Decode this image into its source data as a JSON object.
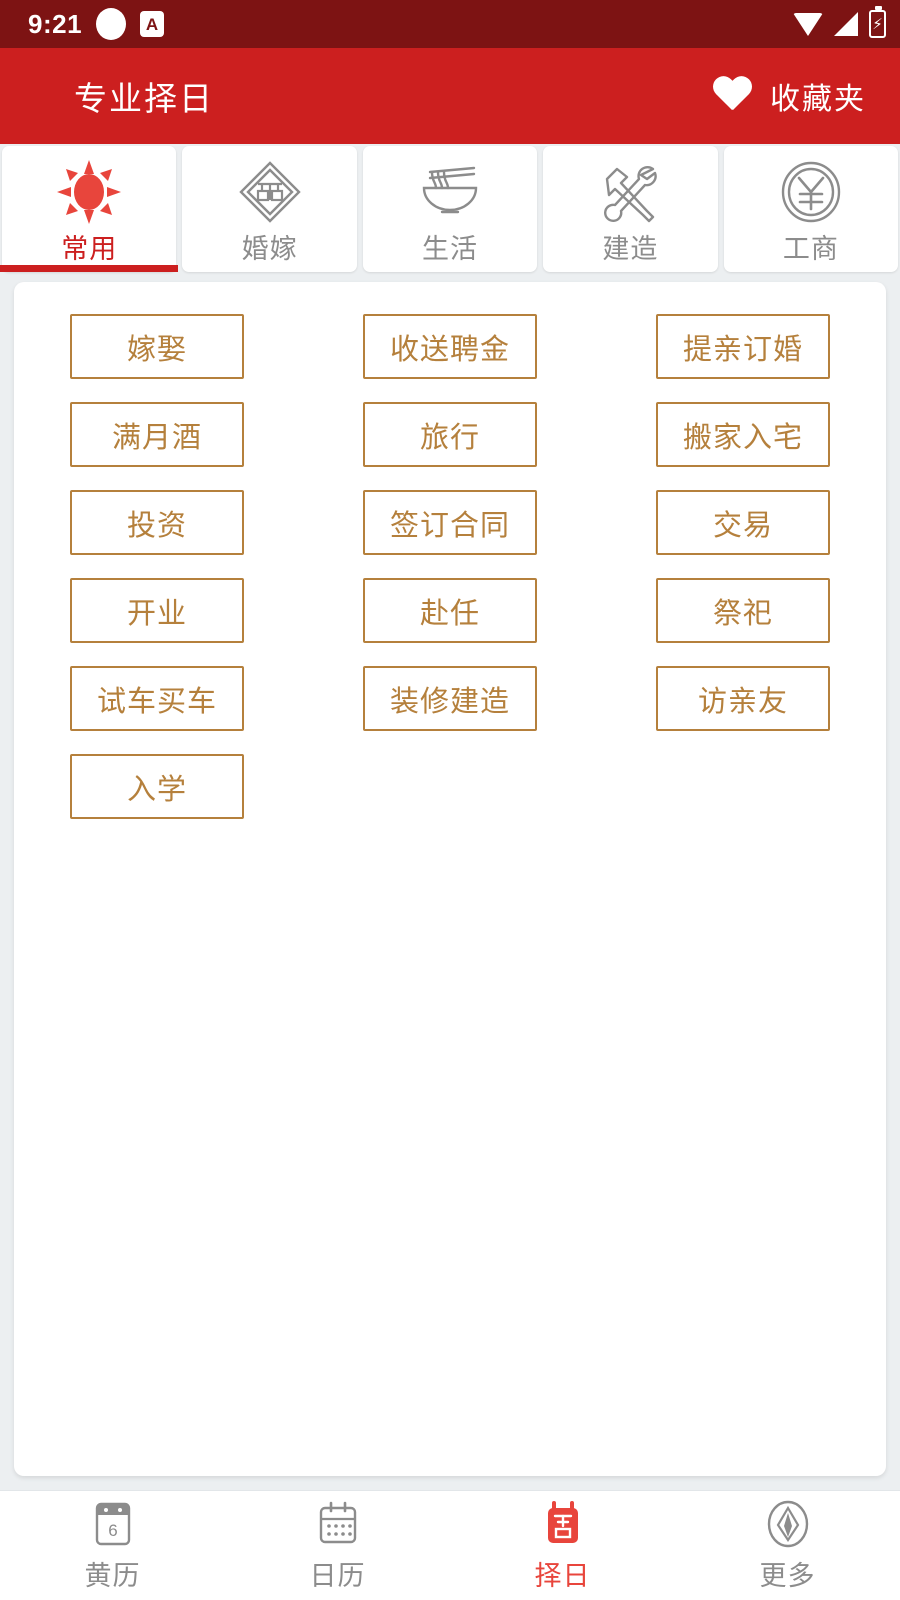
{
  "status_bar": {
    "time": "9:21",
    "icons": [
      "circle-indicator",
      "a-badge-icon",
      "wifi-icon",
      "signal-icon",
      "battery-charging-icon"
    ],
    "battery_glyph": "⚡",
    "a_badge": "A",
    "background": "#7d1313"
  },
  "header": {
    "title": "专业择日",
    "favorites_label": "收藏夹",
    "heart_icon": "heart-icon",
    "background": "#cc1f1f"
  },
  "tabs": {
    "active_index": 0,
    "accent": "#cc1f1f",
    "items": [
      {
        "label": "常用",
        "icon": "sun-icon"
      },
      {
        "label": "婚嫁",
        "icon": "double-happiness-diamond-icon"
      },
      {
        "label": "生活",
        "icon": "noodle-bowl-icon"
      },
      {
        "label": "建造",
        "icon": "hammer-wrench-icon"
      },
      {
        "label": "工商",
        "icon": "yen-coin-icon"
      }
    ]
  },
  "grid": {
    "accent": "#b5803c",
    "columns": 3,
    "buttons": [
      "嫁娶",
      "收送聘金",
      "提亲订婚",
      "满月酒",
      "旅行",
      "搬家入宅",
      "投资",
      "签订合同",
      "交易",
      "开业",
      "赴任",
      "祭祀",
      "试车买车",
      "装修建造",
      "访亲友",
      "入学"
    ]
  },
  "bottom_nav": {
    "active_index": 2,
    "active_color": "#e8453c",
    "items": [
      {
        "label": "黄历",
        "icon": "calendar-day-icon",
        "day": "6"
      },
      {
        "label": "日历",
        "icon": "calendar-month-icon"
      },
      {
        "label": "择日",
        "icon": "lucky-day-icon",
        "glyph": "吉"
      },
      {
        "label": "更多",
        "icon": "more-leaf-icon"
      }
    ]
  }
}
